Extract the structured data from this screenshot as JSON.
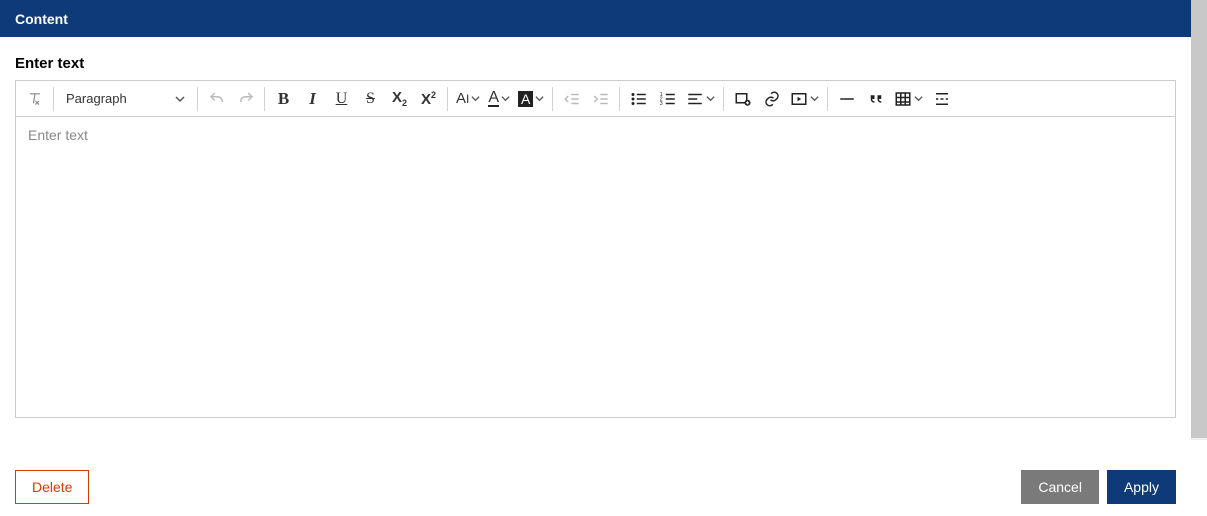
{
  "header": {
    "title": "Content"
  },
  "label": "Enter text",
  "toolbar": {
    "block_format": "Paragraph"
  },
  "editor": {
    "placeholder": "Enter text"
  },
  "footer": {
    "delete": "Delete",
    "cancel": "Cancel",
    "apply": "Apply"
  }
}
